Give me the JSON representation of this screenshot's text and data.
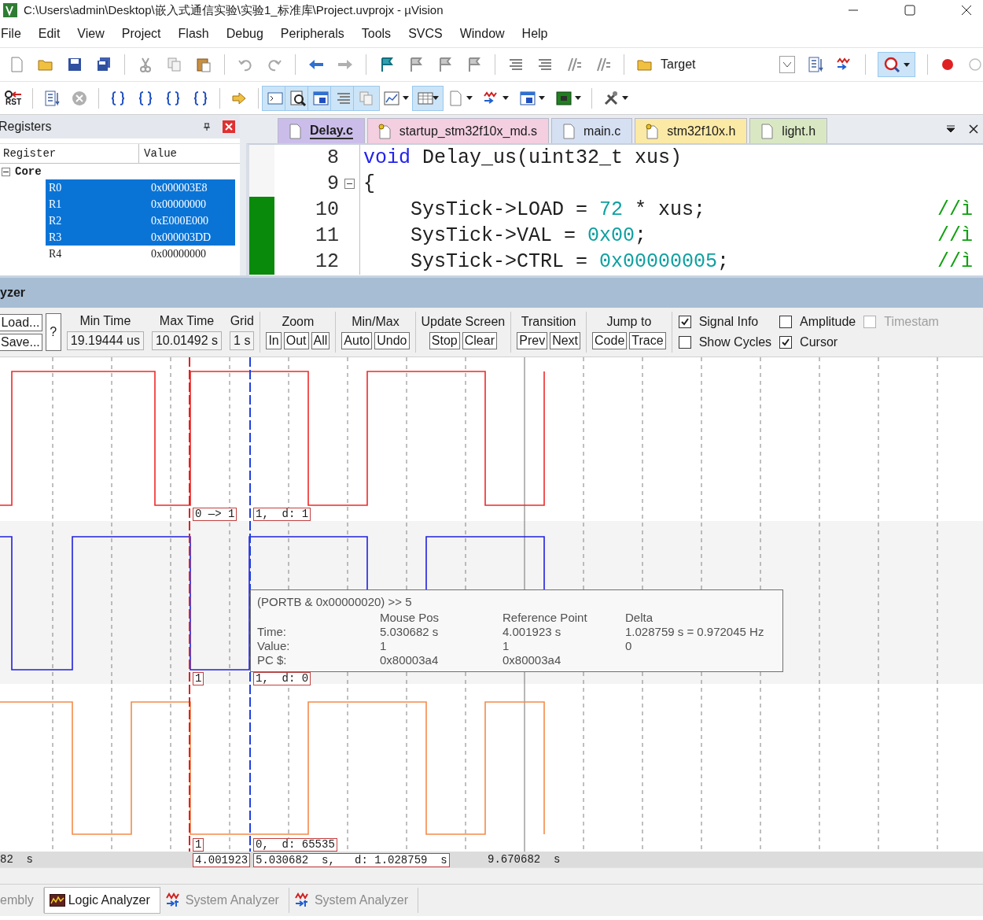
{
  "window": {
    "title": "C:\\Users\\admin\\Desktop\\嵌入式通信实验\\实验1_标准库\\Project.uvprojx - µVision"
  },
  "menu": [
    "File",
    "Edit",
    "View",
    "Project",
    "Flash",
    "Debug",
    "Peripherals",
    "Tools",
    "SVCS",
    "Window",
    "Help"
  ],
  "toolbar": {
    "target": "Target",
    "reset_label": "RST"
  },
  "registers": {
    "title": "Registers",
    "columns": [
      "Register",
      "Value"
    ],
    "group": {
      "name": "Core",
      "expanded": true,
      "rows": [
        {
          "name": "R0",
          "value": "0x000003E8",
          "selected": true
        },
        {
          "name": "R1",
          "value": "0x00000000",
          "selected": true
        },
        {
          "name": "R2",
          "value": "0xE000E000",
          "selected": true
        },
        {
          "name": "R3",
          "value": "0x000003DD",
          "selected": true
        },
        {
          "name": "R4",
          "value": "0x00000000",
          "selected": false
        }
      ]
    }
  },
  "editor": {
    "tabs": [
      {
        "label": "Delay.c",
        "selected": true,
        "color": "#cbbdea",
        "kind": "file"
      },
      {
        "label": "startup_stm32f10x_md.s",
        "selected": false,
        "color": "#f3cfe0",
        "kind": "key-file"
      },
      {
        "label": "main.c",
        "selected": false,
        "color": "#d6e0f3",
        "kind": "file"
      },
      {
        "label": "stm32f10x.h",
        "selected": false,
        "color": "#fbe9a6",
        "kind": "key-file"
      },
      {
        "label": "light.h",
        "selected": false,
        "color": "#d9e8c3",
        "kind": "file"
      }
    ],
    "lines": [
      {
        "number": "8",
        "foldable": false,
        "executed": false,
        "tokens": [
          {
            "text": "void",
            "kind": "keyword"
          },
          {
            "text": " Delay_us(uint32_t xus)",
            "kind": "plain"
          }
        ]
      },
      {
        "number": "9",
        "foldable": true,
        "executed": false,
        "tokens": [
          {
            "text": "{",
            "kind": "plain"
          }
        ]
      },
      {
        "number": "10",
        "foldable": false,
        "executed": true,
        "tokens": [
          {
            "text": "    SysTick->LOAD = ",
            "kind": "plain"
          },
          {
            "text": "72",
            "kind": "number"
          },
          {
            "text": " * xus;",
            "kind": "plain"
          }
        ],
        "comment": "//ì"
      },
      {
        "number": "11",
        "foldable": false,
        "executed": true,
        "tokens": [
          {
            "text": "    SysTick->VAL = ",
            "kind": "plain"
          },
          {
            "text": "0x00",
            "kind": "number"
          },
          {
            "text": ";",
            "kind": "plain"
          }
        ],
        "comment": "//ì"
      },
      {
        "number": "12",
        "foldable": false,
        "executed": true,
        "tokens": [
          {
            "text": "    SysTick->CTRL = ",
            "kind": "plain"
          },
          {
            "text": "0x00000005",
            "kind": "number"
          },
          {
            "text": ";",
            "kind": "plain"
          }
        ],
        "comment": "//ì"
      }
    ]
  },
  "analyzer": {
    "title": "yzer",
    "file_buttons": [
      "Load...",
      "Save..."
    ],
    "help_button": "?",
    "fields": [
      {
        "label": "Min Time",
        "value": "19.19444 us"
      },
      {
        "label": "Max Time",
        "value": "10.01492 s"
      },
      {
        "label": "Grid",
        "value": "1 s"
      }
    ],
    "groups": [
      {
        "label": "Zoom",
        "buttons": [
          "In",
          "Out",
          "All"
        ]
      },
      {
        "label": "Min/Max",
        "buttons": [
          "Auto",
          "Undo"
        ]
      },
      {
        "label": "Update Screen",
        "buttons": [
          "Stop",
          "Clear"
        ]
      },
      {
        "label": "Transition",
        "buttons": [
          "Prev",
          "Next"
        ]
      },
      {
        "label": "Jump to",
        "buttons": [
          "Code",
          "Trace"
        ]
      }
    ],
    "options": [
      {
        "label": "Signal Info",
        "checked": true,
        "disabled": false
      },
      {
        "label": "Show Cycles",
        "checked": false,
        "disabled": false
      },
      {
        "label": "Amplitude",
        "checked": false,
        "disabled": false
      },
      {
        "label": "Cursor",
        "checked": true,
        "disabled": false
      },
      {
        "label": "Timestam",
        "checked": false,
        "disabled": true
      }
    ],
    "signals": [
      {
        "color": "#f02828",
        "cursor_labels": [
          "0 —> 1",
          "1,  d: 1"
        ]
      },
      {
        "color": "#2020e0",
        "cursor_labels": [
          "1",
          "1,  d: 0"
        ]
      },
      {
        "color": "#f58a4a",
        "cursor_labels": [
          "1",
          "0,  d: 65535"
        ]
      }
    ],
    "time_row": {
      "start": "82  s",
      "reference": "4.001923",
      "mouse": "5.030682  s,   d: 1.028759  s",
      "end": "9.670682  s"
    },
    "tooltip": {
      "expression": "(PORTB & 0x00000020) >> 5",
      "columns": [
        "Mouse Pos",
        "Reference Point",
        "Delta"
      ],
      "rows": [
        {
          "label": "Time:",
          "values": [
            "5.030682 s",
            "4.001923 s",
            "1.028759 s = 0.972045 Hz"
          ]
        },
        {
          "label": "Value:",
          "values": [
            "1",
            "1",
            "0"
          ]
        },
        {
          "label": "PC $:",
          "values": [
            "0x80003a4",
            "0x80003a4"
          ]
        }
      ]
    }
  },
  "bottom_tabs": [
    {
      "label": "embly",
      "selected": false,
      "kind": "plain"
    },
    {
      "label": "Logic Analyzer",
      "selected": true,
      "kind": "logic"
    },
    {
      "label": "System Analyzer",
      "selected": false,
      "kind": "system"
    },
    {
      "label": "System Analyzer",
      "selected": false,
      "kind": "system"
    }
  ]
}
